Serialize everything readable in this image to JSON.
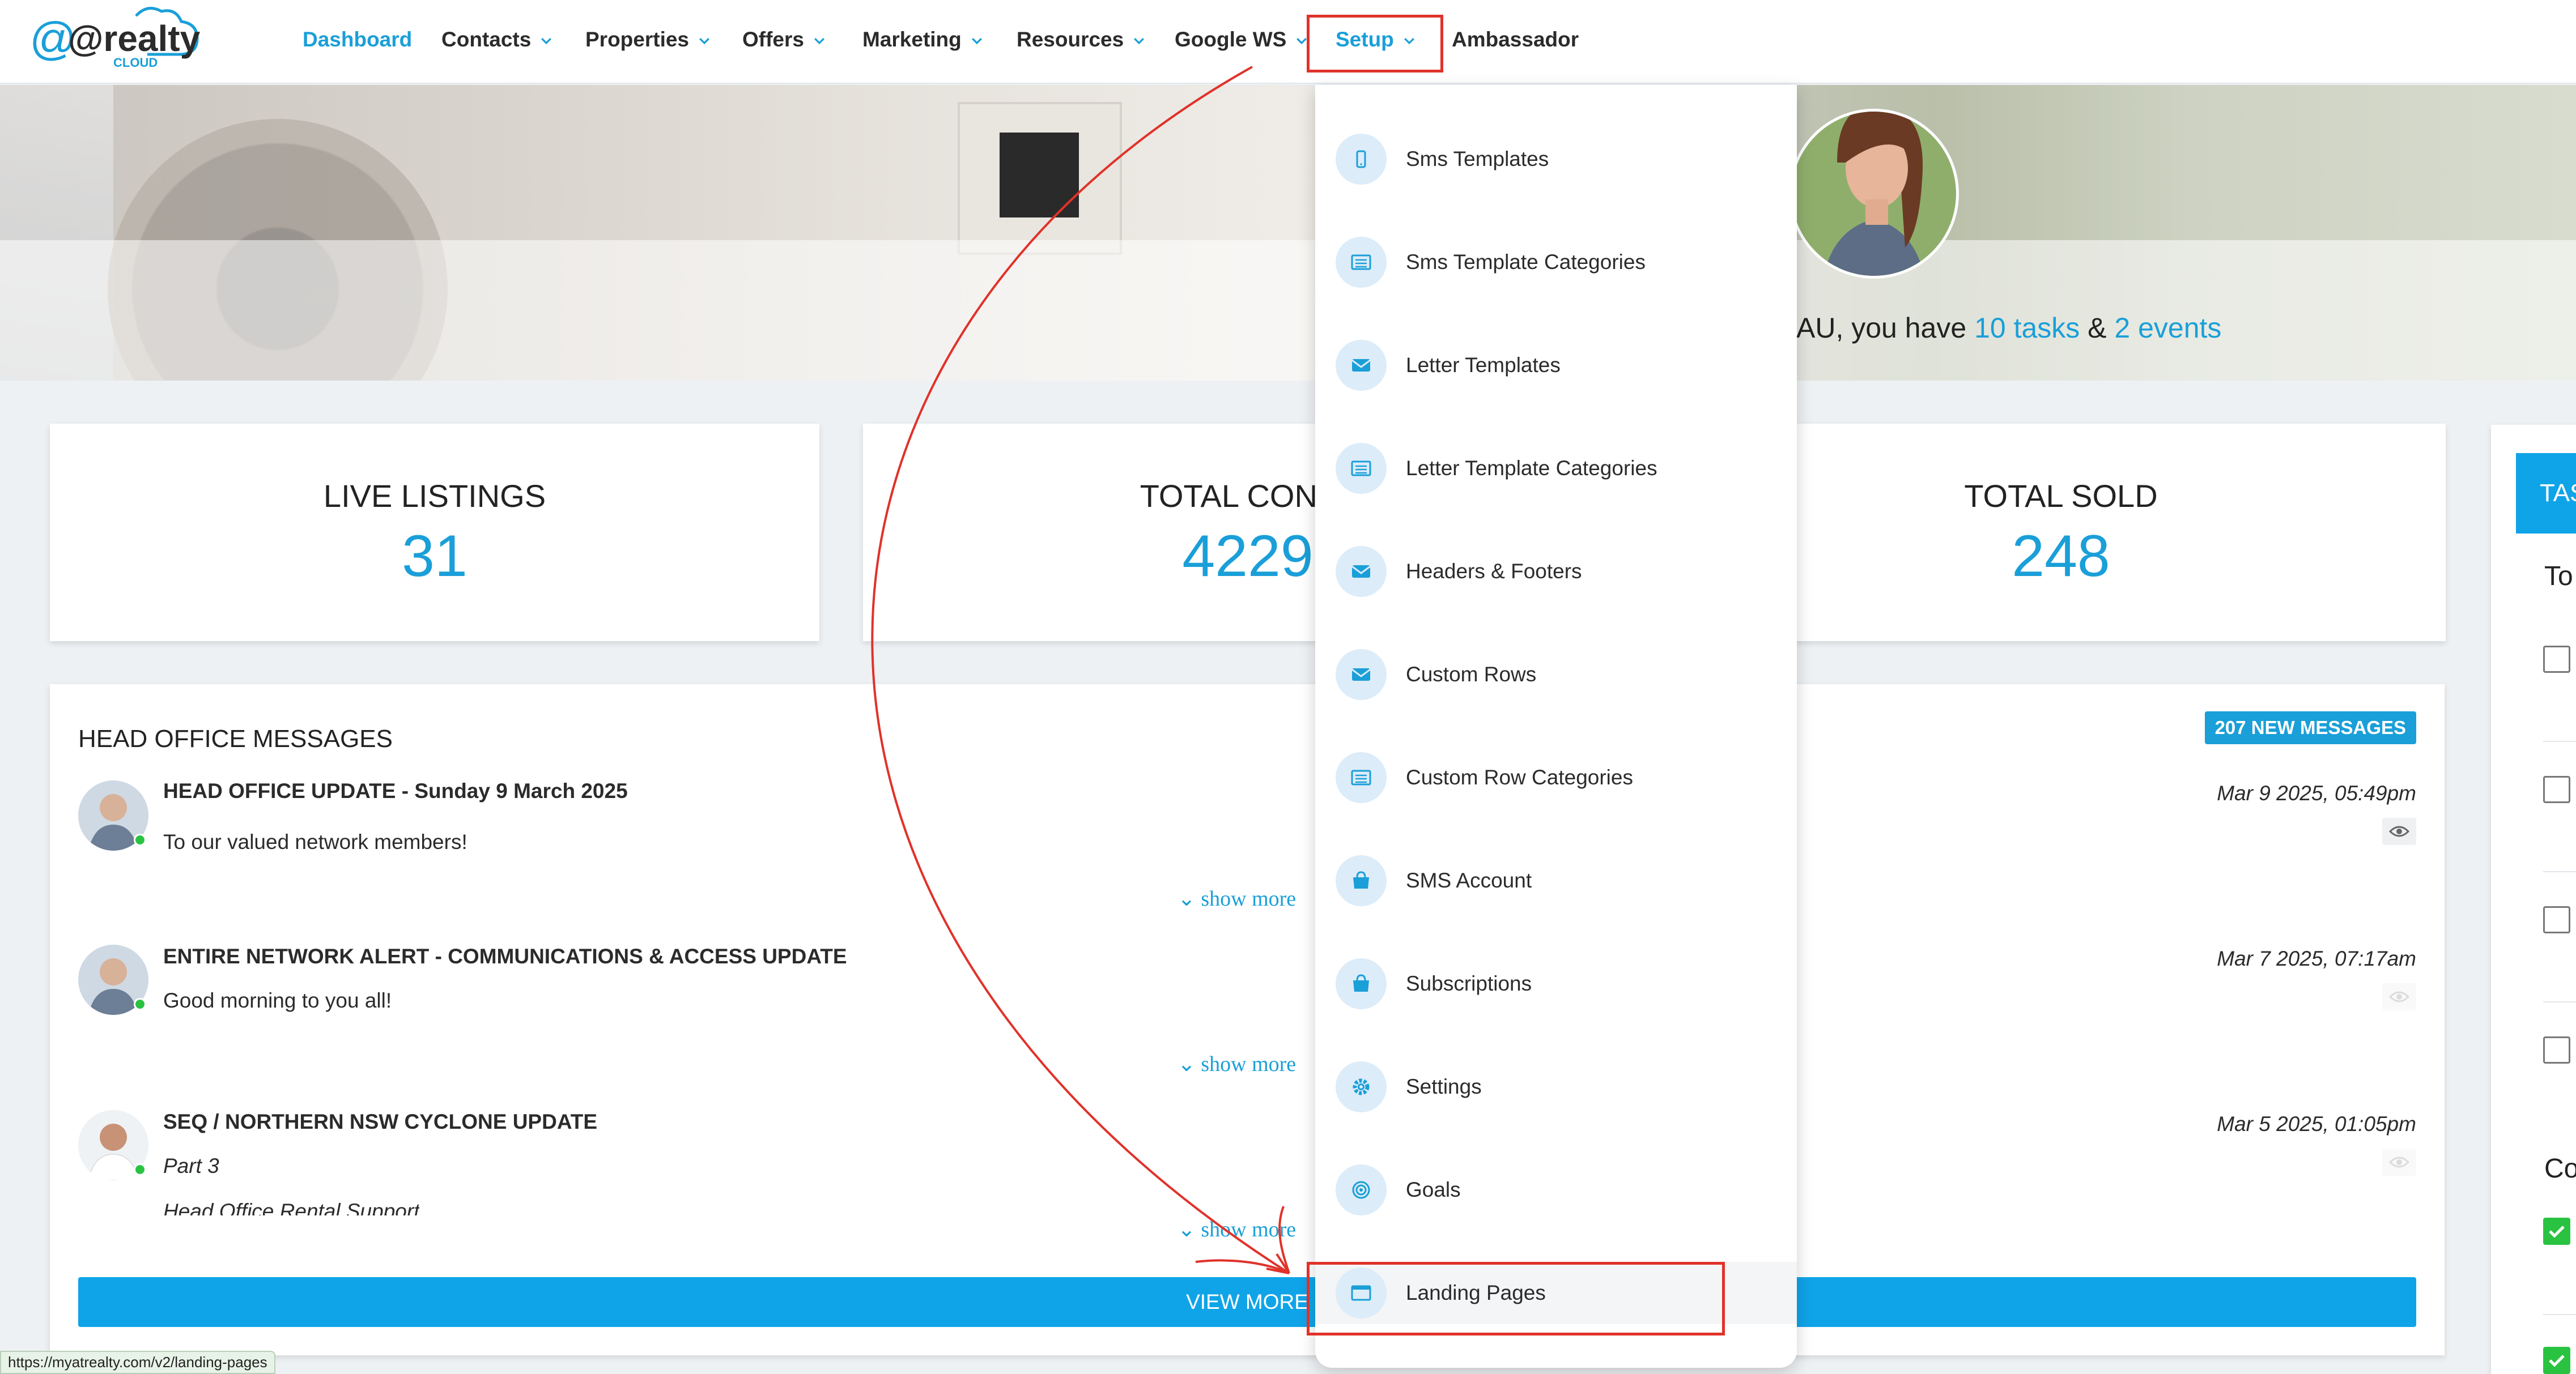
{
  "logo": {
    "text": "@realty",
    "sub": "CLOUD"
  },
  "nav": {
    "dashboard": "Dashboard",
    "contacts": "Contacts",
    "properties": "Properties",
    "offers": "Offers",
    "marketing": "Marketing",
    "resources": "Resources",
    "google_ws": "Google WS",
    "setup": "Setup",
    "ambassador": "Ambassador"
  },
  "hero": {
    "greeting_prefix": "AU, you have ",
    "tasks_link": "10 tasks",
    "amp": " & ",
    "events_link": "2 events"
  },
  "stats": [
    {
      "label": "LIVE LISTINGS",
      "value": "31"
    },
    {
      "label": "TOTAL CONTA",
      "value": "4229"
    },
    {
      "label": "TOTAL SOLD",
      "value": "248"
    }
  ],
  "messages": {
    "title": "HEAD OFFICE MESSAGES",
    "badge": "207 NEW MESSAGES",
    "view_more": "VIEW MORE",
    "show_more": "show more",
    "items": [
      {
        "title": "HEAD OFFICE UPDATE - Sunday 9 March 2025",
        "line1": "To our valued network members!",
        "line2": "",
        "date": "Mar 9 2025, 05:49pm"
      },
      {
        "title": "ENTIRE NETWORK ALERT - COMMUNICATIONS & ACCESS UPDATE",
        "line1": "Good morning to you all!",
        "line2": "",
        "date": "Mar 7 2025, 07:17am"
      },
      {
        "title": "SEQ / NORTHERN NSW CYCLONE UPDATE",
        "line1": "Part 3",
        "line2": "Head Office Rental Support",
        "date": "Mar 5 2025, 01:05pm"
      }
    ]
  },
  "tasks_panel": {
    "tab": "TAS",
    "todo_label": "To",
    "completed_label": "Co"
  },
  "setup_menu": {
    "items": [
      {
        "label": "Sms Templates",
        "icon": "phone-icon"
      },
      {
        "label": "Sms Template Categories",
        "icon": "list-icon"
      },
      {
        "label": "Letter Templates",
        "icon": "envelope-icon"
      },
      {
        "label": "Letter Template Categories",
        "icon": "list-icon"
      },
      {
        "label": "Headers & Footers",
        "icon": "envelope-icon"
      },
      {
        "label": "Custom Rows",
        "icon": "envelope-icon"
      },
      {
        "label": "Custom Row Categories",
        "icon": "list-icon"
      },
      {
        "label": "SMS Account",
        "icon": "shopping-bag-icon"
      },
      {
        "label": "Subscriptions",
        "icon": "shopping-bag-icon"
      },
      {
        "label": "Settings",
        "icon": "gear-icon"
      },
      {
        "label": "Goals",
        "icon": "target-icon"
      },
      {
        "label": "Landing Pages",
        "icon": "window-icon"
      }
    ]
  },
  "status_url": "https://myatrealty.com/v2/landing-pages",
  "colors": {
    "accent": "#1a9fd8",
    "annotation": "#e0322a",
    "online": "#2ac341"
  }
}
